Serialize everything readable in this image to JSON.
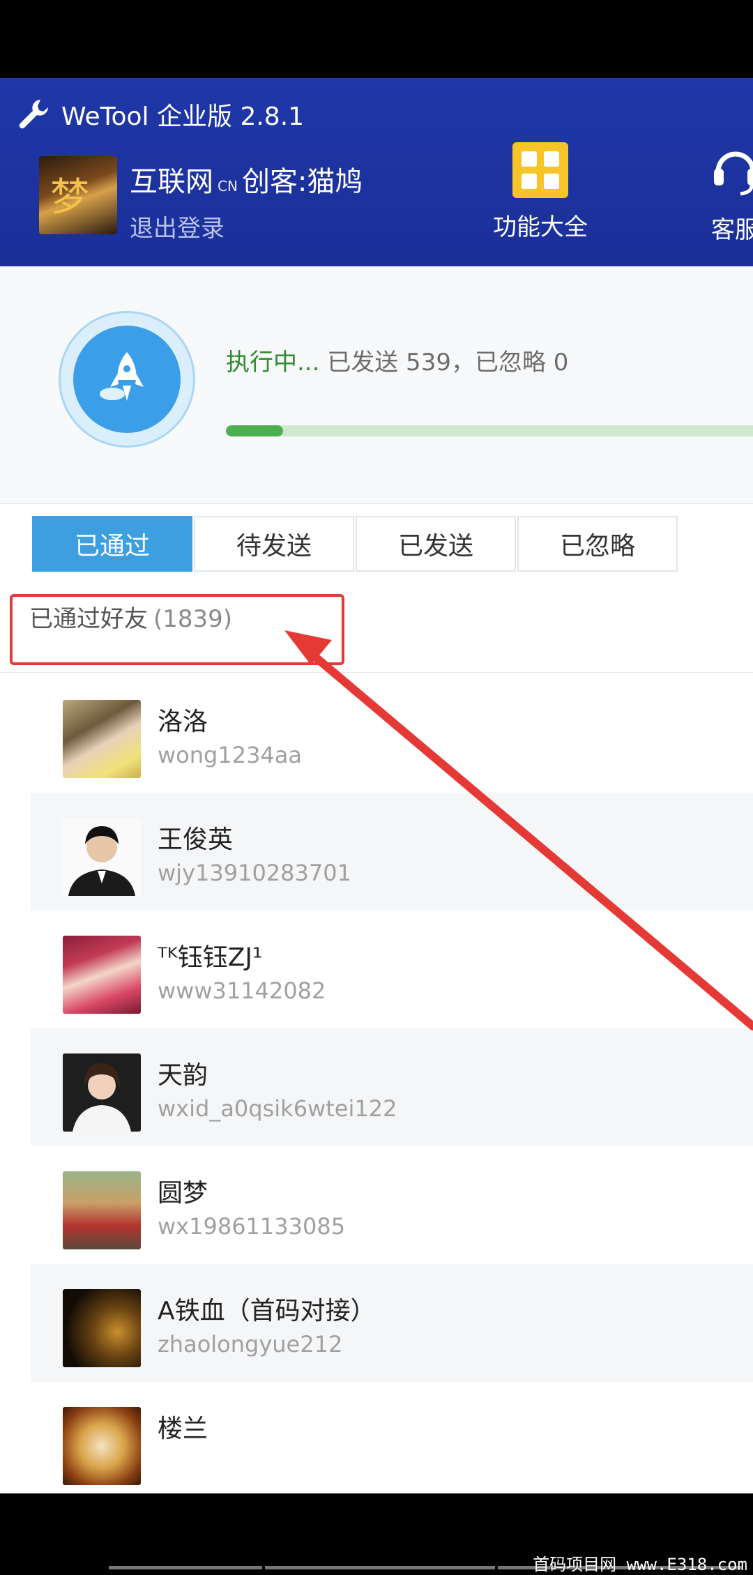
{
  "header": {
    "app_title": "WeTool 企业版 2.8.1",
    "profile": {
      "name": "互联网",
      "name_tag": "CN",
      "name_suffix": "创客:猫鸠",
      "logout": "退出登录"
    },
    "func_button": "功能大全",
    "service_button": "客服",
    "colors": {
      "header_bg": "#1f37a8",
      "func_tile": "#f7c42a"
    }
  },
  "progress": {
    "running_label": "执行中...",
    "detail": "已发送 539，已忽略 0",
    "fraction": 0.108,
    "colors": {
      "fill": "#4caf50",
      "track": "#cfe9cf"
    }
  },
  "tabs": [
    {
      "label": "已通过",
      "active": true
    },
    {
      "label": "待发送",
      "active": false
    },
    {
      "label": "已发送",
      "active": false
    },
    {
      "label": "已忽略",
      "active": false
    }
  ],
  "list": {
    "header": "已通过好友",
    "count": "(1839)"
  },
  "friends": [
    {
      "name": "洛洛",
      "id": "wong1234aa"
    },
    {
      "name": "王俊英",
      "id": "wjy13910283701"
    },
    {
      "name": "ᵀᴷ钰钰ZJ¹",
      "id": "www31142082"
    },
    {
      "name": "天韵",
      "id": "wxid_a0qsik6wtei122"
    },
    {
      "name": "圆梦",
      "id": "wx19861133085"
    },
    {
      "name": "A铁血（首码对接）",
      "id": "zhaolongyue212"
    },
    {
      "name": "楼兰",
      "id": ""
    }
  ],
  "watermark": "首码项目网  www.E318.com"
}
